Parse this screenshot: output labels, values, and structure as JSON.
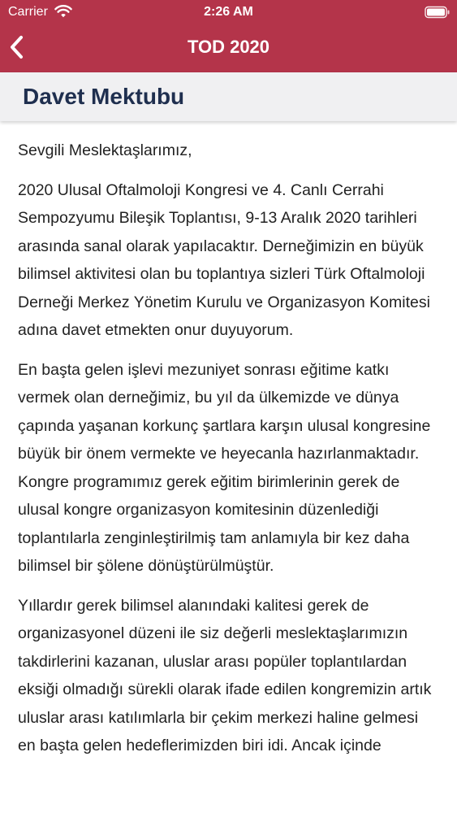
{
  "status_bar": {
    "carrier": "Carrier",
    "time": "2:26 AM",
    "icons": [
      "wifi-icon",
      "battery-icon"
    ]
  },
  "nav": {
    "title": "TOD 2020",
    "back_icon": "chevron-left-icon"
  },
  "section": {
    "title": "Davet Mektubu"
  },
  "content": {
    "greeting": "Sevgili Meslektaşlarımız,",
    "paragraphs": [
      "2020 Ulusal Oftalmoloji Kongresi ve 4. Canlı Cerrahi Sempozyumu Bileşik Toplantısı, 9-13 Aralık 2020 tarihleri arasında sanal olarak yapılacaktır. Derneğimizin en büyük bilimsel aktivitesi olan bu toplantıya sizleri Türk Oftalmoloji Derneği Merkez Yönetim Kurulu ve Organizasyon Komitesi adına davet etmekten onur duyuyorum.",
      "En başta gelen işlevi mezuniyet sonrası eğitime katkı vermek olan derneğimiz, bu yıl da ülkemizde ve dünya çapında yaşanan korkunç şartlara karşın ulusal kongresine büyük bir önem vermekte ve heyecanla hazırlanmaktadır. Kongre programımız gerek eğitim birimlerinin gerek de ulusal kongre organizasyon komitesinin düzenlediği toplantılarla zenginleştirilmiş tam anlamıyla bir kez daha bilimsel bir şölene dönüştürülmüştür.",
      "Yıllardır gerek bilimsel alanındaki kalitesi gerek de organizasyonel düzeni ile siz değerli meslektaşlarımızın takdirlerini kazanan, uluslar arası popüler toplantılardan eksiği olmadığı sürekli olarak ifade edilen kongremizin artık uluslar arası katılımlarla bir çekim merkezi haline gelmesi en başta gelen hedeflerimizden biri idi. Ancak içinde"
    ]
  },
  "colors": {
    "nav_background": "#b4344a",
    "section_background": "#f0f0f2",
    "section_title": "#1f2f4f",
    "body_text": "#222222"
  }
}
